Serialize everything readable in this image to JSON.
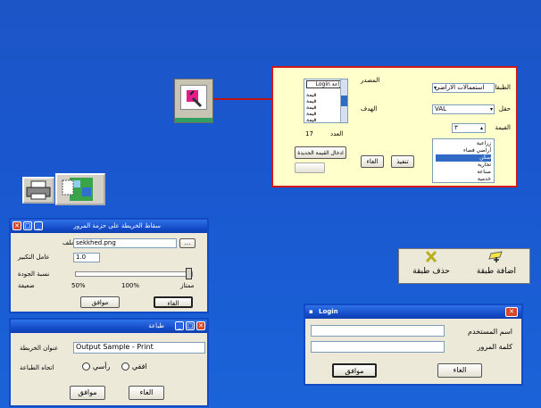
{
  "props": {
    "labels": {
      "layers": "الطبقات",
      "field": "حقل",
      "value": "القيمة",
      "source": "المصدر",
      "target": "الهدف",
      "count": "العدد",
      "count_value": "17"
    },
    "layers_select": "استعمالات الاراضي",
    "field_select": "VAL",
    "value_select": "٣",
    "login_item": "Login زراعة",
    "source_items": [
      "قيمة",
      "قيمة",
      "قيمة",
      "قيمة",
      "قيمة"
    ],
    "value_list": [
      "زراعية",
      "أراضي فضاء",
      "سكن",
      "تجارية",
      "صناعة",
      "خدمية"
    ],
    "buttons": {
      "cancel": "الغاء",
      "execute": "تنفيذ",
      "enter_value": "ادخال القيمة الجديدة"
    }
  },
  "layer_buttons": {
    "add": "اضافة طبقة",
    "delete": "حذف طبقة"
  },
  "settings_dialog": {
    "title": "سقاط الخريطة على حزمة المرور",
    "file_label": "ملف",
    "file_value": "sekkhed.png",
    "scale_label": "عامل التكبير",
    "scale_value": "1.0",
    "smooth_label": "نسبة الجودة",
    "low_label": "ضعيفة",
    "mid_left": "50%",
    "mid_right": "100%",
    "high_label": "ممتاز",
    "ok": "موافق",
    "cancel": "الغاء"
  },
  "print_dialog": {
    "title": "طباعة",
    "map_title_label": "عنوان الخريطة",
    "map_title_value": "Output Sample - Print",
    "orientation_label": "اتجاه الطباعة",
    "horizontal": "افقي",
    "vertical": "رأسي",
    "ok": "موافق",
    "cancel": "الغاء"
  },
  "login_dialog": {
    "title": "Login",
    "username_label": "اسم المستخدم",
    "password_label": "كلمة المرور",
    "username_value": "",
    "password_value": "",
    "ok": "موافق",
    "cancel": "الغاء"
  }
}
